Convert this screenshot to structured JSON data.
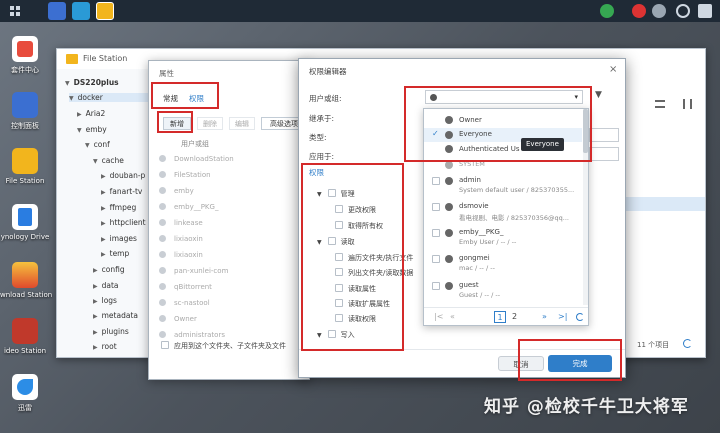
{
  "desktop": {
    "icons": [
      {
        "label": "套件中心",
        "color": "#e84c3d"
      },
      {
        "label": "控制面板",
        "color": "#3b6fd1"
      },
      {
        "label": "File Station",
        "color": "#f2b51d"
      },
      {
        "label": "ynology Drive",
        "color": "#2a7de1"
      },
      {
        "label": "wnload Station",
        "color": "#f08a1c"
      },
      {
        "label": "ideo Station",
        "color": "#c0392b"
      },
      {
        "label": "迅雷",
        "color": "#2c8de6"
      }
    ]
  },
  "file_station": {
    "title": "File Station",
    "tree": [
      "DS220plus",
      "docker",
      "Aria2",
      "emby",
      "conf",
      "cache",
      "douban-p",
      "fanart-tv",
      "ffmpeg",
      "httpclient",
      "images",
      "temp",
      "config",
      "data",
      "logs",
      "metadata",
      "plugins",
      "root",
      "transcoding"
    ],
    "footer_count": "11 个项目"
  },
  "properties": {
    "title": "属性",
    "tabs": [
      "常规",
      "权限"
    ],
    "toolbar": {
      "add": "新增",
      "delete": "删除",
      "edit": "编辑",
      "advanced": "高级选项"
    },
    "list_header": "用户或组",
    "list": [
      "DownloadStation",
      "FileStation",
      "emby",
      "emby__PKG_",
      "linkease",
      "lixiaoxin",
      "lixiaoxin",
      "pan-xunlei-com",
      "qBittorrent",
      "sc-nastool",
      "Owner",
      "administrators"
    ],
    "apply_label": "应用到这个文件夹、子文件夹及文件"
  },
  "permission_editor": {
    "title": "权限编辑器",
    "fields": {
      "user_or_group": "用户或组:",
      "inherit_from": "继承于:",
      "type": "类型:",
      "apply_to": "应用于:"
    },
    "section_label": "权限",
    "groups": [
      {
        "name": "管理",
        "items": [
          "更改权限",
          "取得所有权"
        ]
      },
      {
        "name": "读取",
        "items": [
          "遍历文件夹/执行文件",
          "列出文件夹/读取数据",
          "读取属性",
          "读取扩展属性",
          "读取权限"
        ]
      },
      {
        "name": "写入",
        "items": []
      }
    ],
    "cancel": "取消",
    "done": "完成"
  },
  "dropdown": {
    "entries": [
      {
        "name": "Owner",
        "sub": "",
        "type": "group",
        "checked": false
      },
      {
        "name": "Everyone",
        "sub": "",
        "type": "group",
        "checked": true
      },
      {
        "name": "Authenticated Us",
        "sub": "",
        "type": "group",
        "checked": false
      },
      {
        "name": "SYSTEM",
        "sub": "",
        "type": "group",
        "checked": false
      },
      {
        "name": "admin",
        "sub": "System default user / 825370355...",
        "type": "user",
        "checked": false
      },
      {
        "name": "dsmovie",
        "sub": "看电视剧、电影 / 825370356@qq...",
        "type": "user",
        "checked": false
      },
      {
        "name": "emby__PKG_",
        "sub": "Emby User / -- / --",
        "type": "user",
        "checked": false
      },
      {
        "name": "gongmei",
        "sub": "mac / -- / --",
        "type": "user",
        "checked": false
      },
      {
        "name": "guest",
        "sub": "Guest / -- / --",
        "type": "user",
        "checked": false
      }
    ],
    "pages": [
      "1",
      "2"
    ],
    "tooltip": "Everyone"
  },
  "watermark": "知乎 @检校千牛卫大将军"
}
